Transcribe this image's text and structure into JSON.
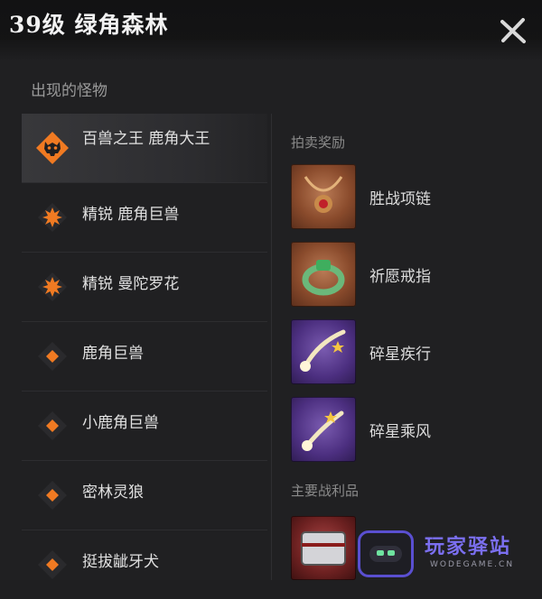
{
  "title": "39级 绿角森林",
  "icons": {
    "close": "close-icon"
  },
  "monsters_section": {
    "label": "出现的怪物"
  },
  "monsters": [
    {
      "name": "百兽之王 鹿角大王",
      "rank": "boss",
      "icon": "boss-skull-icon",
      "selected": true
    },
    {
      "name": "精锐 鹿角巨兽",
      "rank": "elite",
      "icon": "elite-burst-icon"
    },
    {
      "name": "精锐 曼陀罗花",
      "rank": "elite",
      "icon": "elite-burst-icon"
    },
    {
      "name": "鹿角巨兽",
      "rank": "normal",
      "icon": "diamond-icon"
    },
    {
      "name": "小鹿角巨兽",
      "rank": "normal",
      "icon": "diamond-icon"
    },
    {
      "name": "密林灵狼",
      "rank": "normal",
      "icon": "diamond-icon"
    },
    {
      "name": "挺拔龇牙犬",
      "rank": "normal",
      "icon": "diamond-icon"
    }
  ],
  "auction_section": {
    "label": "拍卖奖励"
  },
  "auction_rewards": [
    {
      "name": "胜战项链",
      "icon": "necklace-icon"
    },
    {
      "name": "祈愿戒指",
      "icon": "ring-icon"
    },
    {
      "name": "碎星疾行",
      "icon": "shooting-star-icon"
    },
    {
      "name": "碎星乘风",
      "icon": "shooting-star-icon"
    }
  ],
  "loot_section": {
    "label": "主要战利品"
  },
  "loot": [
    {
      "icon": "treasure-chest-icon"
    }
  ],
  "watermark": {
    "title": "玩家驿站",
    "url": "WODEGAME.CN"
  },
  "colors": {
    "accent_orange": "#f07a22",
    "background": "#202022",
    "text": "#e0e0e0",
    "muted": "#8a8a8a"
  }
}
